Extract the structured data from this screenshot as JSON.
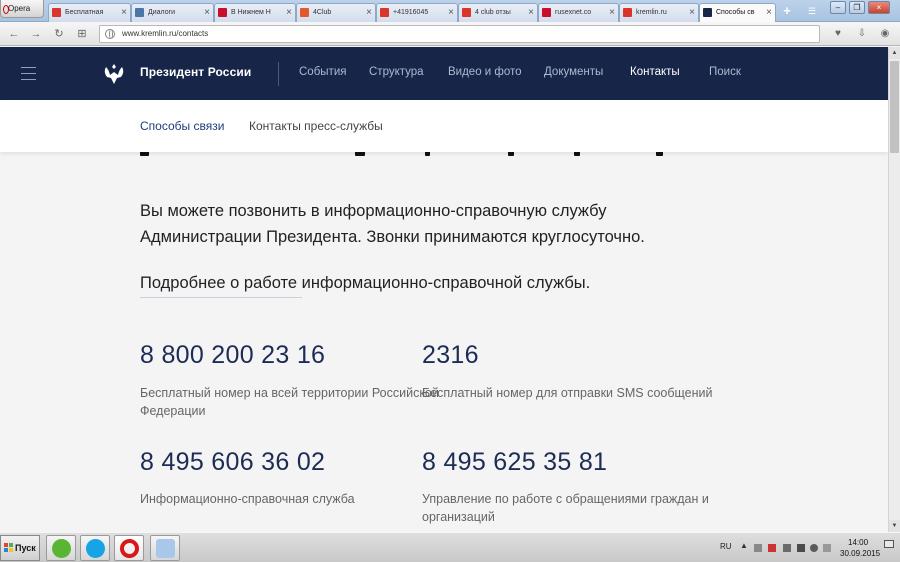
{
  "browser": {
    "menu_label": "Opera",
    "tabs": [
      {
        "label": "Бесплатная",
        "favicon_color": "#d9352a"
      },
      {
        "label": "Диалоги",
        "favicon_color": "#4a76a8"
      },
      {
        "label": "В Нижнем Н",
        "favicon_color": "#c8102e"
      },
      {
        "label": "4Club",
        "favicon_color": "#e05a2b"
      },
      {
        "label": "+41916045",
        "favicon_color": "#d9352a"
      },
      {
        "label": "4 club отзы",
        "favicon_color": "#d9352a"
      },
      {
        "label": "rusexnet.co",
        "favicon_color": "#c8102e"
      },
      {
        "label": "kremlin.ru",
        "favicon_color": "#d9352a"
      },
      {
        "label": "Способы св",
        "favicon_color": "#162548"
      }
    ],
    "address": "www.kremlin.ru/contacts"
  },
  "site": {
    "title": "Президент России",
    "nav": [
      "События",
      "Структура",
      "Видео и фото",
      "Документы",
      "Контакты",
      "Поиск"
    ],
    "current_nav": "Контакты",
    "subnav": [
      "Способы связи",
      "Контакты пресс-службы"
    ],
    "brand_color": "#162548"
  },
  "content": {
    "intro": "Вы можете позвонить в информационно-справочную службу Администрации Президента. Звонки принимаются круглосуточно.",
    "more_link": "Подробнее о работе информационно-справочной службы.",
    "phones": [
      {
        "number": "8 800 200 23 16",
        "description": "Бесплатный номер на всей территории Российской Федерации"
      },
      {
        "number": "2316",
        "description": "Бесплатный номер для отправки SMS сообщений"
      },
      {
        "number": "8 495 606 36 02",
        "description": "Информационно-справочная служба"
      },
      {
        "number": "8 495 625 35 81",
        "description": "Управление по работе с обращениями граждан и организаций"
      }
    ]
  },
  "taskbar": {
    "start_label": "Пуск",
    "language": "RU",
    "time": "14:00",
    "date": "30.09.2015"
  }
}
